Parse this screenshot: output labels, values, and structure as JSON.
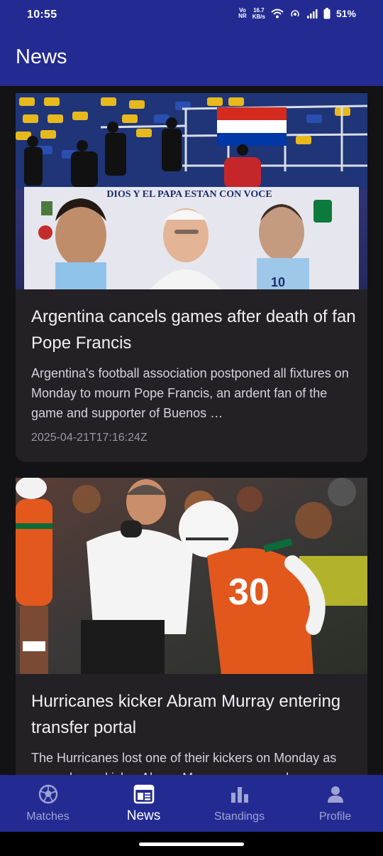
{
  "status": {
    "time": "10:55",
    "volte_top": "Vo",
    "volte_bottom": "NR",
    "speed_value": "16.7",
    "speed_unit": "KB/s",
    "battery": "51%"
  },
  "app_bar": {
    "title": "News"
  },
  "articles": [
    {
      "title": "Argentina cancels games after death of fan Pope Francis",
      "description": "Argentina's football association postponed all fixtures on Monday to mourn Pope Francis, an ardent fan of the game and supporter of Buenos …",
      "date": "2025-04-21T17:16:24Z",
      "banner_text": "DIOS Y EL PAPA ESTAN CON VOCE"
    },
    {
      "title": "Hurricanes kicker Abram Murray entering transfer portal",
      "description": "The Hurricanes lost one of their kickers on Monday as second-year kicker Abram Murray announced",
      "jersey_number": "30"
    }
  ],
  "bottom_nav": {
    "items": [
      {
        "label": "Matches",
        "icon": "soccer-ball-icon",
        "active": false
      },
      {
        "label": "News",
        "icon": "newspaper-icon",
        "active": true
      },
      {
        "label": "Standings",
        "icon": "bar-chart-icon",
        "active": false
      },
      {
        "label": "Profile",
        "icon": "person-icon",
        "active": false
      }
    ]
  },
  "colors": {
    "primary": "#232b92",
    "background": "#131215",
    "card": "#232126"
  }
}
